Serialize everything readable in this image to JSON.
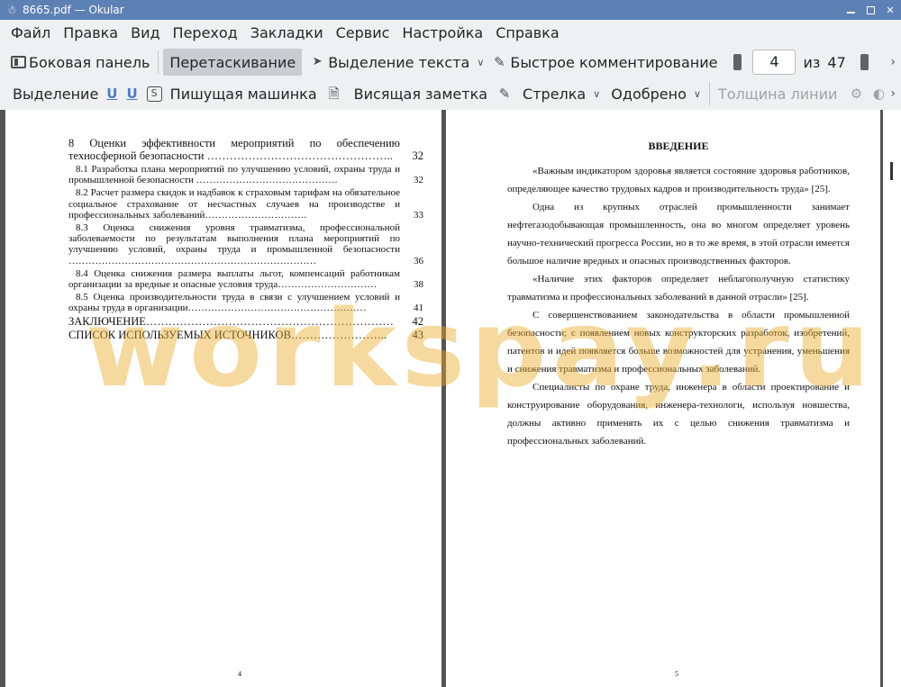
{
  "window": {
    "title": "8665.pdf  — Okular"
  },
  "menu": [
    "Файл",
    "Правка",
    "Вид",
    "Переход",
    "Закладки",
    "Сервис",
    "Настройка",
    "Справка"
  ],
  "toolbar": {
    "sidebar": "Боковая панель",
    "drag": "Перетаскивание",
    "text_select": "Выделение текста",
    "quick_comment": "Быстрое комментирование",
    "page_current": "4",
    "page_of": "из",
    "page_total": "47"
  },
  "annot_toolbar": {
    "highlight": "Выделение",
    "u1": "U",
    "u2": "U",
    "strike": "S",
    "typewriter": "Пишущая машинка",
    "popup_note": "Висящая заметка",
    "arrow": "Стрелка",
    "stamp": "Одобрено",
    "line_width": "Толщина линии"
  },
  "left_page": {
    "number": "4",
    "toc": [
      {
        "text": "8 Оценки эффективности мероприятий по обеспечению техносферной безопасности …………………………………………..",
        "page": "32",
        "level": 1
      },
      {
        "text": "8.1 Разработка плана мероприятий по улучшению условий, охраны труда и промышленной безопасности …………………………………….",
        "page": "32",
        "level": 2
      },
      {
        "text": "8.2 Расчет размера скидок и надбавок к страховым тарифам на обязательное социальное страхование от несчастных случаев на производстве и профессиональных заболеваний………………………….",
        "page": "33",
        "level": 2
      },
      {
        "text": "8.3 Оценка снижения уровня травматизма, профессиональной заболеваемости по результатам выполнения плана мероприятий по улучшению условий, охраны труда и промышленной безопасности …………………………………………………………………",
        "page": "36",
        "level": 2
      },
      {
        "text": "8.4 Оценка снижения размера выплаты льгот, компенсаций работникам организации за вредные и опасные условия труда…………………………",
        "page": "38",
        "level": 2
      },
      {
        "text": "8.5 Оценка производительности труда в связи с улучшением условий и охраны труда в организации………………………………………………",
        "page": "41",
        "level": 2
      },
      {
        "text": "ЗАКЛЮЧЕНИЕ…………………………………………………………",
        "page": "42",
        "level": 0
      },
      {
        "text": "СПИСОК ИСПОЛЬЗУЕМЫХ ИСТОЧНИКОВ……………………..",
        "page": "43",
        "level": 0
      }
    ]
  },
  "right_page": {
    "number": "5",
    "heading": "ВВЕДЕНИЕ",
    "paragraphs": [
      "«Важным индикатором здоровья является состояние здоровья работников, определяющее качество трудовых кадров и производительность труда» [25].",
      "Одна из крупных отраслей промышленности занимает нефтегазодобывающая промышленность, она во многом определяет уровень научно-технический прогресса России, но в то же время, в этой отрасли имеется большое наличие вредных и опасных производственных факторов.",
      "«Наличие этих факторов определяет неблагополучную статистику травматизма и профессиональных заболеваний в данной отрасли» [25].",
      "С совершенствованием законодательства в области промышленной безопасности; с появлением новых конструкторских разработок, изобретений, патентов и идей появляется больше возможностей для устранения, уменьшения и снижения травматизма и профессиональных заболеваний.",
      "Специалисты по охране труда, инженера в области проектирование и конструирование оборудования, инженера-технологи, используя новшества, должны активно применять их с целью снижения травматизма и профессиональных заболеваний."
    ]
  },
  "watermark": "workspay.ru"
}
